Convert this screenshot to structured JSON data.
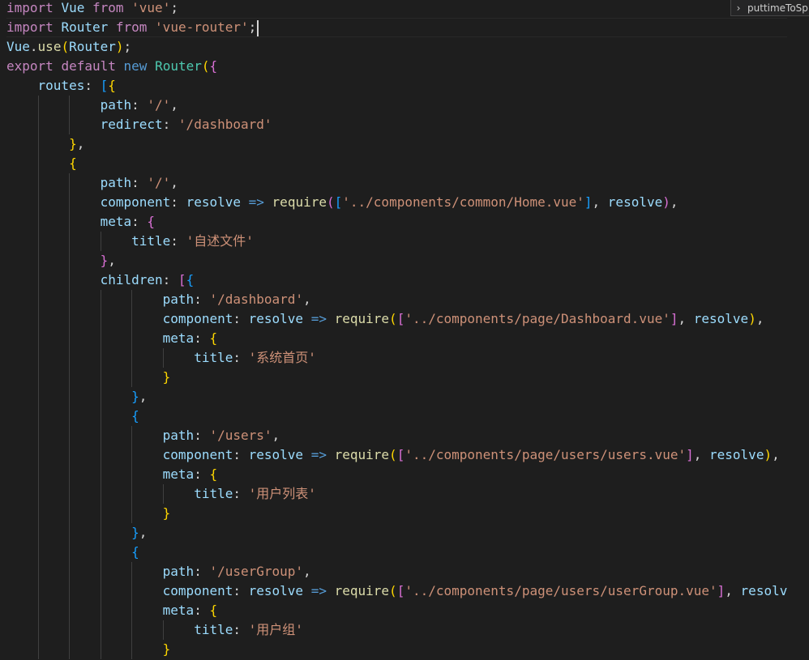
{
  "editor": {
    "find_widget": {
      "toggle_glyph": "›",
      "value": "puttimeToSp"
    },
    "lines": [
      {
        "tokens": [
          [
            "kw",
            "import"
          ],
          [
            "punc",
            " "
          ],
          [
            "ident",
            "Vue"
          ],
          [
            "punc",
            " "
          ],
          [
            "kw",
            "from"
          ],
          [
            "punc",
            " "
          ],
          [
            "str",
            "'vue'"
          ],
          [
            "punc",
            ";"
          ]
        ]
      },
      {
        "tokens": [
          [
            "kw",
            "import"
          ],
          [
            "punc",
            " "
          ],
          [
            "ident",
            "Router"
          ],
          [
            "punc",
            " "
          ],
          [
            "kw",
            "from"
          ],
          [
            "punc",
            " "
          ],
          [
            "str",
            "'vue-router'"
          ],
          [
            "punc",
            ";"
          ]
        ],
        "cursor": true
      },
      {
        "tokens": [
          [
            "ident",
            "Vue"
          ],
          [
            "punc",
            "."
          ],
          [
            "fn",
            "use"
          ],
          [
            "b1",
            "("
          ],
          [
            "ident",
            "Router"
          ],
          [
            "b1",
            ")"
          ],
          [
            "punc",
            ";"
          ]
        ]
      },
      {
        "tokens": [
          [
            "kw",
            "export"
          ],
          [
            "punc",
            " "
          ],
          [
            "kw",
            "default"
          ],
          [
            "punc",
            " "
          ],
          [
            "kb",
            "new"
          ],
          [
            "punc",
            " "
          ],
          [
            "cls",
            "Router"
          ],
          [
            "b1",
            "("
          ],
          [
            "b2",
            "{"
          ]
        ]
      },
      {
        "tokens": [
          [
            "ident",
            "    routes"
          ],
          [
            "punc",
            ": "
          ],
          [
            "b3",
            "["
          ],
          [
            "b1",
            "{"
          ]
        ]
      },
      {
        "tokens": [
          [
            "ident",
            "            path"
          ],
          [
            "punc",
            ": "
          ],
          [
            "str",
            "'/'"
          ],
          [
            "punc",
            ","
          ]
        ]
      },
      {
        "tokens": [
          [
            "ident",
            "            redirect"
          ],
          [
            "punc",
            ": "
          ],
          [
            "str",
            "'/dashboard'"
          ]
        ]
      },
      {
        "tokens": [
          [
            "b1",
            "        }"
          ],
          [
            "punc",
            ","
          ]
        ]
      },
      {
        "tokens": [
          [
            "b1",
            "        {"
          ]
        ]
      },
      {
        "tokens": [
          [
            "ident",
            "            path"
          ],
          [
            "punc",
            ": "
          ],
          [
            "str",
            "'/'"
          ],
          [
            "punc",
            ","
          ]
        ]
      },
      {
        "tokens": [
          [
            "ident",
            "            component"
          ],
          [
            "punc",
            ": "
          ],
          [
            "ident",
            "resolve"
          ],
          [
            "punc",
            " "
          ],
          [
            "kb",
            "=>"
          ],
          [
            "punc",
            " "
          ],
          [
            "fn",
            "require"
          ],
          [
            "b2",
            "("
          ],
          [
            "b3",
            "["
          ],
          [
            "str",
            "'../components/common/Home.vue'"
          ],
          [
            "b3",
            "]"
          ],
          [
            "punc",
            ", "
          ],
          [
            "ident",
            "resolve"
          ],
          [
            "b2",
            ")"
          ],
          [
            "punc",
            ","
          ]
        ]
      },
      {
        "tokens": [
          [
            "ident",
            "            meta"
          ],
          [
            "punc",
            ": "
          ],
          [
            "b2",
            "{"
          ]
        ]
      },
      {
        "tokens": [
          [
            "ident",
            "                title"
          ],
          [
            "punc",
            ": "
          ],
          [
            "str",
            "'自述文件'"
          ]
        ]
      },
      {
        "tokens": [
          [
            "b2",
            "            }"
          ],
          [
            "punc",
            ","
          ]
        ]
      },
      {
        "tokens": [
          [
            "ident",
            "            children"
          ],
          [
            "punc",
            ": "
          ],
          [
            "b2",
            "["
          ],
          [
            "b3",
            "{"
          ]
        ]
      },
      {
        "tokens": [
          [
            "ident",
            "                    path"
          ],
          [
            "punc",
            ": "
          ],
          [
            "str",
            "'/dashboard'"
          ],
          [
            "punc",
            ","
          ]
        ]
      },
      {
        "tokens": [
          [
            "ident",
            "                    component"
          ],
          [
            "punc",
            ": "
          ],
          [
            "ident",
            "resolve"
          ],
          [
            "punc",
            " "
          ],
          [
            "kb",
            "=>"
          ],
          [
            "punc",
            " "
          ],
          [
            "fn",
            "require"
          ],
          [
            "b1",
            "("
          ],
          [
            "b2",
            "["
          ],
          [
            "str",
            "'../components/page/Dashboard.vue'"
          ],
          [
            "b2",
            "]"
          ],
          [
            "punc",
            ", "
          ],
          [
            "ident",
            "resolve"
          ],
          [
            "b1",
            ")"
          ],
          [
            "punc",
            ","
          ]
        ]
      },
      {
        "tokens": [
          [
            "ident",
            "                    meta"
          ],
          [
            "punc",
            ": "
          ],
          [
            "b1",
            "{"
          ]
        ]
      },
      {
        "tokens": [
          [
            "ident",
            "                        title"
          ],
          [
            "punc",
            ": "
          ],
          [
            "str",
            "'系统首页'"
          ]
        ]
      },
      {
        "tokens": [
          [
            "b1",
            "                    }"
          ]
        ]
      },
      {
        "tokens": [
          [
            "b3",
            "                }"
          ],
          [
            "punc",
            ","
          ]
        ]
      },
      {
        "tokens": [
          [
            "b3",
            "                {"
          ]
        ]
      },
      {
        "tokens": [
          [
            "ident",
            "                    path"
          ],
          [
            "punc",
            ": "
          ],
          [
            "str",
            "'/users'"
          ],
          [
            "punc",
            ","
          ]
        ]
      },
      {
        "tokens": [
          [
            "ident",
            "                    component"
          ],
          [
            "punc",
            ": "
          ],
          [
            "ident",
            "resolve"
          ],
          [
            "punc",
            " "
          ],
          [
            "kb",
            "=>"
          ],
          [
            "punc",
            " "
          ],
          [
            "fn",
            "require"
          ],
          [
            "b1",
            "("
          ],
          [
            "b2",
            "["
          ],
          [
            "str",
            "'../components/page/users/users.vue'"
          ],
          [
            "b2",
            "]"
          ],
          [
            "punc",
            ", "
          ],
          [
            "ident",
            "resolve"
          ],
          [
            "b1",
            ")"
          ],
          [
            "punc",
            ","
          ]
        ]
      },
      {
        "tokens": [
          [
            "ident",
            "                    meta"
          ],
          [
            "punc",
            ": "
          ],
          [
            "b1",
            "{"
          ]
        ]
      },
      {
        "tokens": [
          [
            "ident",
            "                        title"
          ],
          [
            "punc",
            ": "
          ],
          [
            "str",
            "'用户列表'"
          ]
        ]
      },
      {
        "tokens": [
          [
            "b1",
            "                    }"
          ]
        ]
      },
      {
        "tokens": [
          [
            "b3",
            "                }"
          ],
          [
            "punc",
            ","
          ]
        ]
      },
      {
        "tokens": [
          [
            "b3",
            "                {"
          ]
        ]
      },
      {
        "tokens": [
          [
            "ident",
            "                    path"
          ],
          [
            "punc",
            ": "
          ],
          [
            "str",
            "'/userGroup'"
          ],
          [
            "punc",
            ","
          ]
        ]
      },
      {
        "tokens": [
          [
            "ident",
            "                    component"
          ],
          [
            "punc",
            ": "
          ],
          [
            "ident",
            "resolve"
          ],
          [
            "punc",
            " "
          ],
          [
            "kb",
            "=>"
          ],
          [
            "punc",
            " "
          ],
          [
            "fn",
            "require"
          ],
          [
            "b1",
            "("
          ],
          [
            "b2",
            "["
          ],
          [
            "str",
            "'../components/page/users/userGroup.vue'"
          ],
          [
            "b2",
            "]"
          ],
          [
            "punc",
            ", "
          ],
          [
            "ident",
            "resolv"
          ]
        ]
      },
      {
        "tokens": [
          [
            "ident",
            "                    meta"
          ],
          [
            "punc",
            ": "
          ],
          [
            "b1",
            "{"
          ]
        ]
      },
      {
        "tokens": [
          [
            "ident",
            "                        title"
          ],
          [
            "punc",
            ": "
          ],
          [
            "str",
            "'用户组'"
          ]
        ]
      },
      {
        "tokens": [
          [
            "b1",
            "                    }"
          ]
        ]
      }
    ]
  }
}
